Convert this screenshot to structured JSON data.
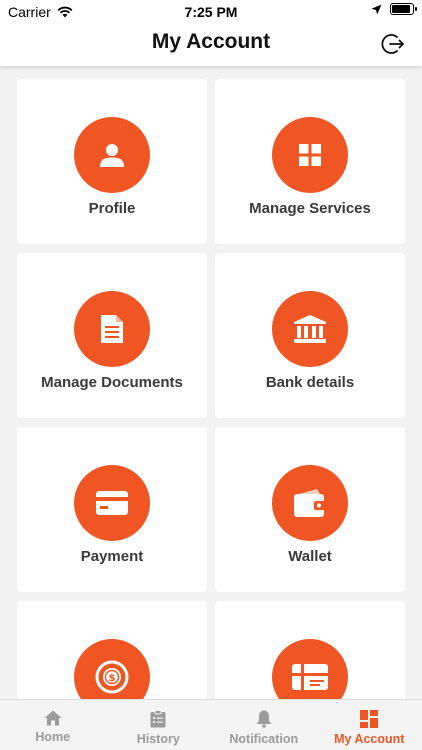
{
  "status": {
    "carrier": "Carrier",
    "time": "7:25 PM"
  },
  "header": {
    "title": "My Account",
    "logout_icon": "logout-icon"
  },
  "colors": {
    "accent": "#ef5623",
    "tab_inactive": "#9b9b9b",
    "label": "#3a3a3a"
  },
  "cards": [
    {
      "label": "Profile",
      "icon": "person-icon"
    },
    {
      "label": "Manage Services",
      "icon": "grid-icon"
    },
    {
      "label": "Manage Documents",
      "icon": "document-icon"
    },
    {
      "label": "Bank details",
      "icon": "bank-icon"
    },
    {
      "label": "Payment",
      "icon": "credit-card-icon"
    },
    {
      "label": "Wallet",
      "icon": "wallet-icon"
    },
    {
      "label": "",
      "icon": "coin-icon"
    },
    {
      "label": "",
      "icon": "gift-card-icon"
    }
  ],
  "tabs": [
    {
      "label": "Home",
      "icon": "home-icon",
      "active": false
    },
    {
      "label": "History",
      "icon": "clipboard-icon",
      "active": false
    },
    {
      "label": "Notification",
      "icon": "bell-icon",
      "active": false
    },
    {
      "label": "My Account",
      "icon": "dashboard-icon",
      "active": true
    }
  ]
}
